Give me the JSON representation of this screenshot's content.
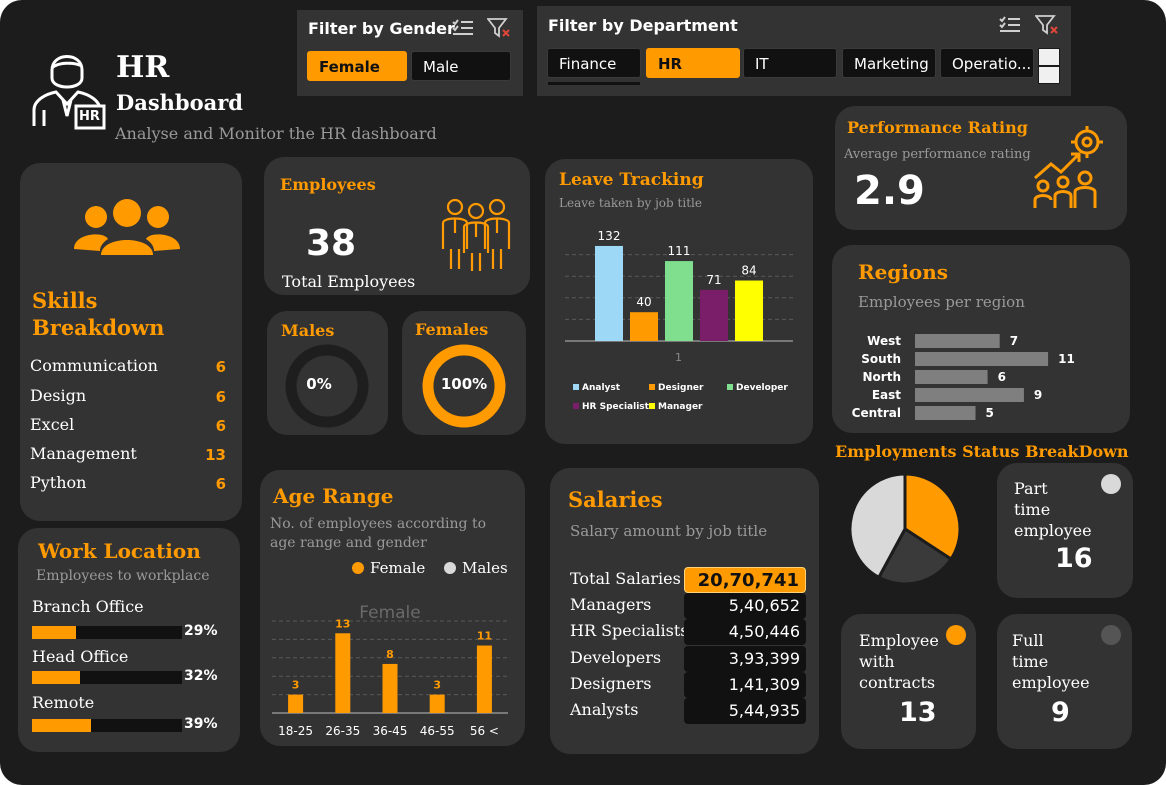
{
  "header": {
    "title_line1": "HR",
    "title_line2": "Dashboard",
    "tagline": "Analyse and Monitor the HR dashboard",
    "logo_badge": "HR"
  },
  "filter_gender": {
    "title": "Filter by Gender",
    "options": [
      {
        "label": "Female",
        "selected": true
      },
      {
        "label": "Male",
        "selected": false
      }
    ]
  },
  "filter_department": {
    "title": "Filter by Department",
    "options": [
      {
        "label": "Finance",
        "selected": false
      },
      {
        "label": "HR",
        "selected": true
      },
      {
        "label": "IT",
        "selected": false
      },
      {
        "label": "Marketing",
        "selected": false
      },
      {
        "label": "Operatio...",
        "selected": false
      }
    ]
  },
  "skills": {
    "title_line1": "Skills",
    "title_line2": "Breakdown",
    "items": [
      {
        "name": "Communication",
        "count": "6"
      },
      {
        "name": "Design",
        "count": "6"
      },
      {
        "name": "Excel",
        "count": "6"
      },
      {
        "name": "Management",
        "count": "13"
      },
      {
        "name": "Python",
        "count": "6"
      }
    ]
  },
  "employees": {
    "title": "Employees",
    "value": "38",
    "label": "Total Employees"
  },
  "males": {
    "title": "Males",
    "value": "0%",
    "fraction": 0
  },
  "females": {
    "title": "Females",
    "value": "100%",
    "fraction": 1
  },
  "leave": {
    "title": "Leave Tracking",
    "subtitle": "Leave taken by job title",
    "x_tick": "1",
    "legend": [
      "Analyst",
      "Designer",
      "Developer",
      "HR Specialist",
      "Manager"
    ]
  },
  "performance": {
    "title": "Performance Rating",
    "subtitle": "Average performance rating",
    "value": "2.9"
  },
  "regions": {
    "title": "Regions",
    "subtitle": "Employees per region"
  },
  "work_location": {
    "title": "Work Location",
    "subtitle": "Employees  to workplace",
    "items": [
      {
        "name": "Branch Office",
        "pct": "29%",
        "fraction": 0.29
      },
      {
        "name": "Head Office",
        "pct": "32%",
        "fraction": 0.32
      },
      {
        "name": "Remote",
        "pct": "39%",
        "fraction": 0.39
      }
    ]
  },
  "age_range": {
    "title": "Age Range",
    "subtitle_line1": "No. of employees  according to",
    "subtitle_line2": "age range and gender",
    "legend": [
      {
        "label": "Female",
        "color": "#ff9a00"
      },
      {
        "label": "Males",
        "color": "#d9d9d9"
      }
    ]
  },
  "salaries": {
    "title": "Salaries",
    "subtitle": "Salary amount by job title",
    "rows": [
      {
        "label": "Total Salaries",
        "value": "20,70,741",
        "highlight": true
      },
      {
        "label": "Managers",
        "value": "5,40,652",
        "highlight": false
      },
      {
        "label": "HR Specialists",
        "value": "4,50,446",
        "highlight": false
      },
      {
        "label": "Developers",
        "value": "3,93,399",
        "highlight": false
      },
      {
        "label": "Designers",
        "value": "1,41,309",
        "highlight": false
      },
      {
        "label": "Analysts",
        "value": "5,44,935",
        "highlight": false
      }
    ]
  },
  "employment_status": {
    "title": "Employments Status BreakDown",
    "part_time": {
      "label_line1": "Part",
      "label_line2": "time",
      "label_line3": "employee",
      "value": "16",
      "dot_color": "#d9d9d9"
    },
    "contracts": {
      "label_line1": "Employee",
      "label_line2": "with",
      "label_line3": "contracts",
      "value": "13",
      "dot_color": "#ff9a00"
    },
    "full_time": {
      "label_line1": "Full",
      "label_line2": "time",
      "label_line3": "employee",
      "value": "9",
      "dot_color": "#555555"
    }
  },
  "colors": {
    "accent": "#ff9a00",
    "card": "#333333",
    "background": "#1c1c1c"
  },
  "chart_data": [
    {
      "type": "bar",
      "title": "Leave Tracking",
      "categories": [
        "1"
      ],
      "series": [
        {
          "name": "Analyst",
          "values": [
            132
          ],
          "color": "#9dd9f7"
        },
        {
          "name": "Designer",
          "values": [
            40
          ],
          "color": "#ff9a00"
        },
        {
          "name": "Developer",
          "values": [
            111
          ],
          "color": "#7fdf8f"
        },
        {
          "name": "HR Specialist",
          "values": [
            71
          ],
          "color": "#7b1e6a"
        },
        {
          "name": "Manager",
          "values": [
            84
          ],
          "color": "#ffff00"
        }
      ],
      "ylim": [
        0,
        150
      ],
      "grid": true,
      "legend": "bottom"
    },
    {
      "type": "bar",
      "title": "Female",
      "categories": [
        "18-25",
        "26-35",
        "36-45",
        "46-55",
        "56 <"
      ],
      "series": [
        {
          "name": "Female",
          "values": [
            3,
            13,
            8,
            3,
            11
          ],
          "color": "#ff9a00"
        }
      ],
      "ylim": [
        0,
        15
      ],
      "grid": true
    },
    {
      "type": "bar",
      "title": "Regions",
      "categories": [
        "West",
        "South",
        "North",
        "East",
        "Central"
      ],
      "values": [
        7,
        11,
        6,
        9,
        5
      ],
      "orientation": "horizontal",
      "color": "#7f7f7f"
    },
    {
      "type": "pie",
      "title": "Employments Status BreakDown",
      "categories": [
        "Employee with contracts",
        "Full time employee",
        "Part time employee"
      ],
      "values": [
        13,
        9,
        16
      ],
      "colors": [
        "#ff9a00",
        "#3a3a3a",
        "#d9d9d9"
      ]
    }
  ]
}
